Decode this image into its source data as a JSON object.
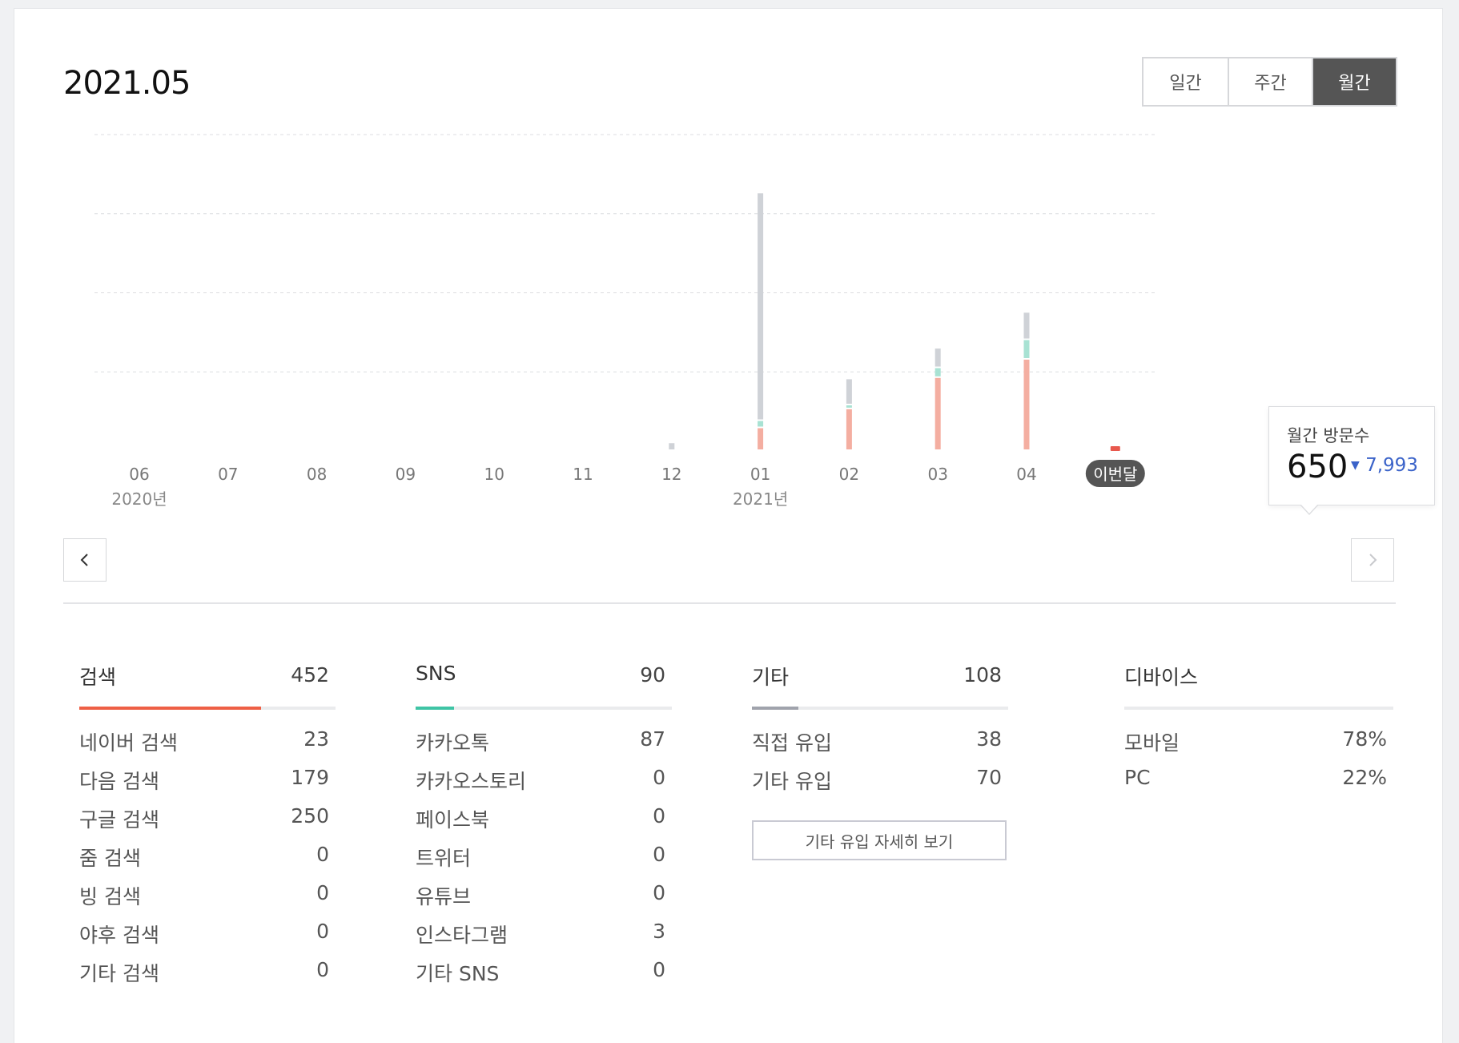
{
  "header": {
    "period": "2021.05"
  },
  "period_tabs": [
    {
      "label": "일간",
      "active": false
    },
    {
      "label": "주간",
      "active": false
    },
    {
      "label": "월간",
      "active": true
    }
  ],
  "colors": {
    "search": "#f4aea1",
    "sns": "#a8e2d3",
    "etc": "#cfd2d7",
    "current": "#e8584d",
    "current_badge": "#555555",
    "search_accent": "#ee5f45",
    "sns_accent": "#3fc4a5",
    "etc_accent": "#a0a3ac",
    "delta_down": "#3b63c9"
  },
  "chart_data": {
    "type": "bar",
    "stacked": true,
    "categories": [
      "06",
      "07",
      "08",
      "09",
      "10",
      "11",
      "12",
      "01",
      "02",
      "03",
      "04",
      "이번달"
    ],
    "year_labels": [
      {
        "at": "06",
        "text": "2020년"
      },
      {
        "at": "01",
        "text": "2021년"
      }
    ],
    "series": [
      {
        "name": "검색",
        "values": [
          0,
          0,
          0,
          0,
          0,
          0,
          0,
          350,
          640,
          1120,
          1400,
          0
        ]
      },
      {
        "name": "SNS",
        "values": [
          0,
          0,
          0,
          0,
          0,
          0,
          0,
          110,
          60,
          150,
          300,
          0
        ]
      },
      {
        "name": "기타",
        "values": [
          0,
          0,
          0,
          0,
          0,
          0,
          120,
          3490,
          400,
          300,
          420,
          0
        ]
      }
    ],
    "current_month_total": 650,
    "ylim": [
      0,
      4850
    ],
    "gridlines": 4,
    "grid": "dashed"
  },
  "tooltip": {
    "label": "월간 방문수",
    "value": "650",
    "delta": "7,993",
    "delta_direction": "down"
  },
  "stats": {
    "search": {
      "title": "검색",
      "total": "452",
      "share": 0.71,
      "rows": [
        {
          "label": "네이버 검색",
          "value": "23"
        },
        {
          "label": "다음 검색",
          "value": "179"
        },
        {
          "label": "구글 검색",
          "value": "250"
        },
        {
          "label": "줌 검색",
          "value": "0"
        },
        {
          "label": "빙 검색",
          "value": "0"
        },
        {
          "label": "야후 검색",
          "value": "0"
        },
        {
          "label": "기타 검색",
          "value": "0"
        }
      ]
    },
    "sns": {
      "title": "SNS",
      "total": "90",
      "share": 0.15,
      "rows": [
        {
          "label": "카카오톡",
          "value": "87"
        },
        {
          "label": "카카오스토리",
          "value": "0"
        },
        {
          "label": "페이스북",
          "value": "0"
        },
        {
          "label": "트위터",
          "value": "0"
        },
        {
          "label": "유튜브",
          "value": "0"
        },
        {
          "label": "인스타그램",
          "value": "3"
        },
        {
          "label": "기타 SNS",
          "value": "0"
        }
      ]
    },
    "etc": {
      "title": "기타",
      "total": "108",
      "share": 0.18,
      "rows": [
        {
          "label": "직접 유입",
          "value": "38"
        },
        {
          "label": "기타 유입",
          "value": "70"
        }
      ],
      "detail_button": "기타 유입 자세히 보기"
    },
    "device": {
      "title": "디바이스",
      "rows": [
        {
          "label": "모바일",
          "value": "78%"
        },
        {
          "label": "PC",
          "value": "22%"
        }
      ]
    }
  },
  "icons": {
    "prev": "chevron-left-icon",
    "next": "chevron-right-icon"
  }
}
